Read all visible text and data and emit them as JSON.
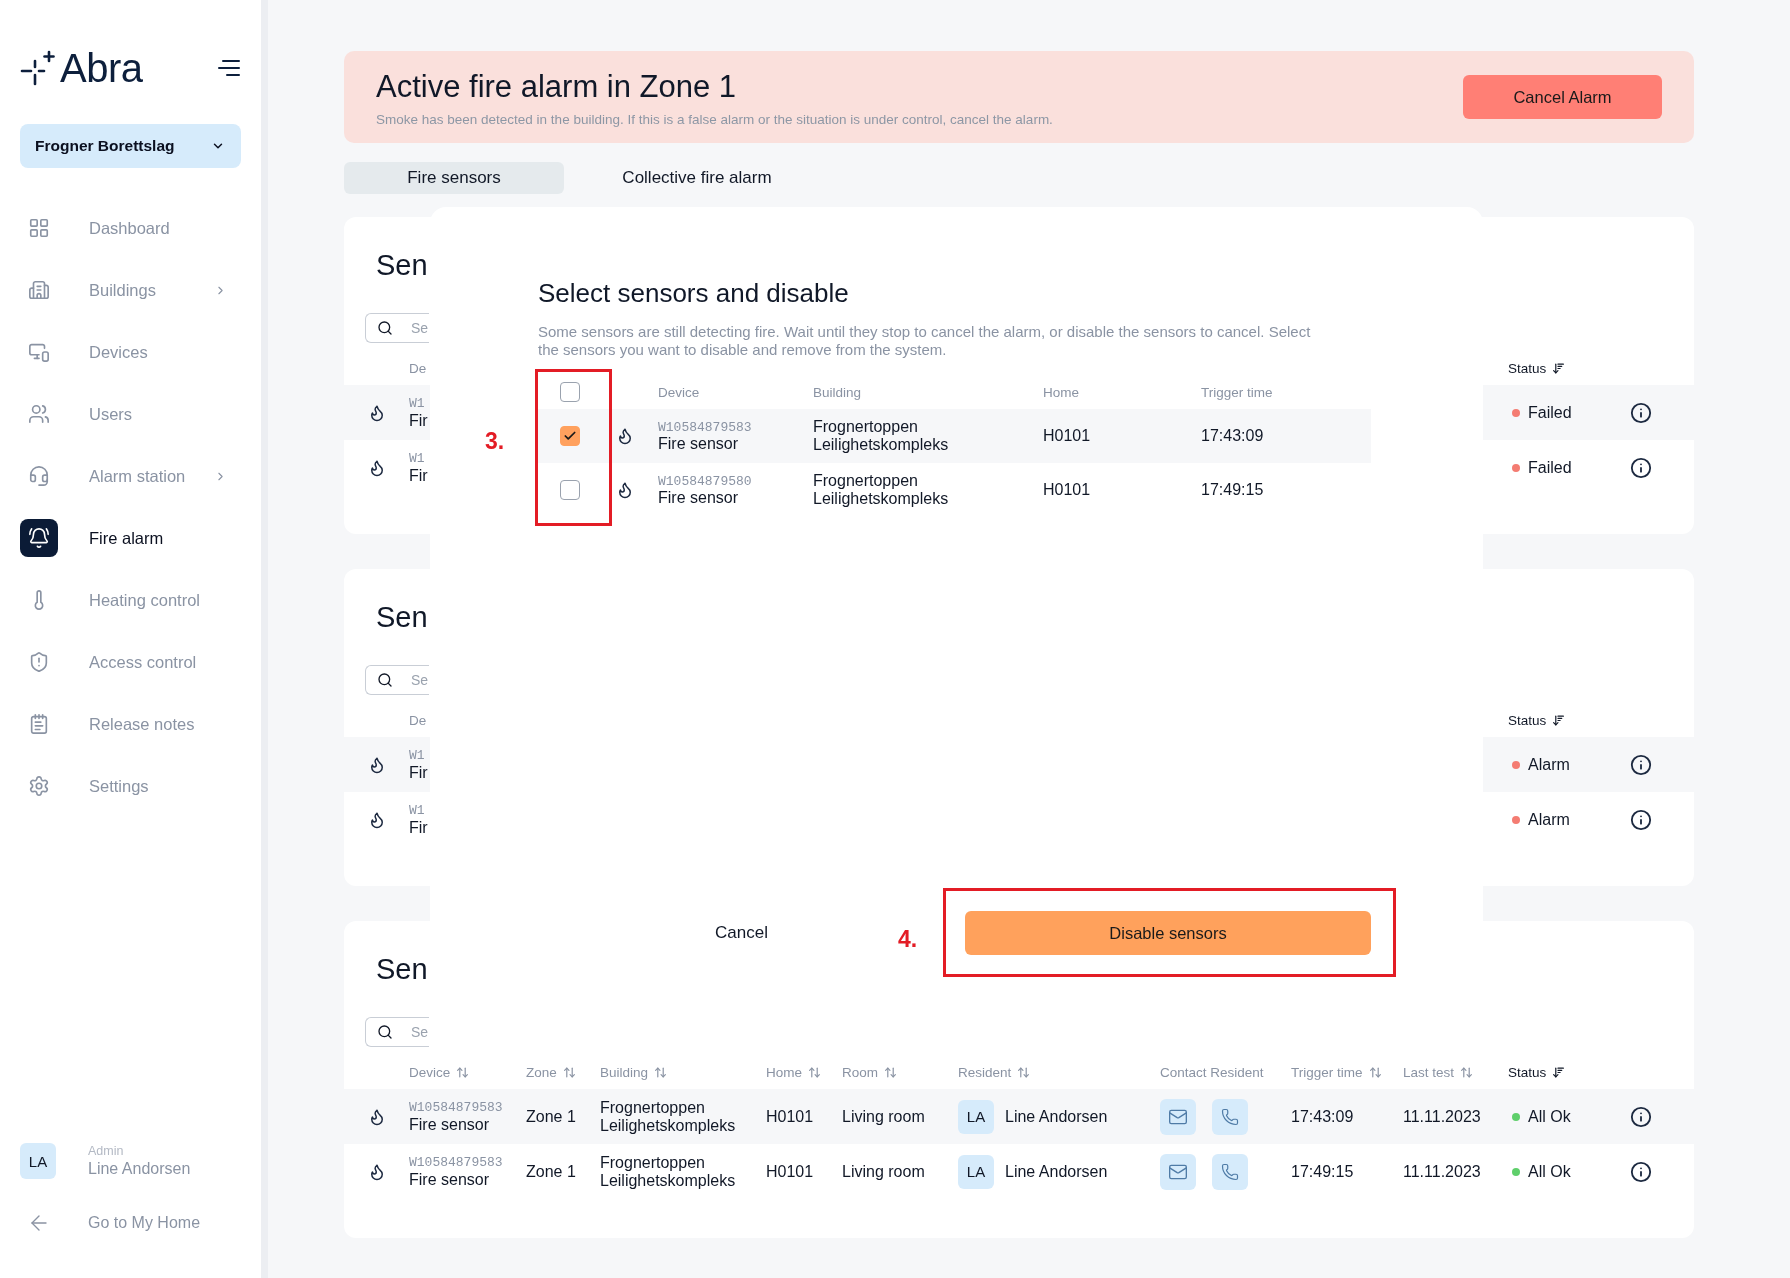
{
  "sidebar": {
    "logo": "Abra",
    "org_selector": {
      "value": "Frogner Borettslag"
    },
    "nav_items": [
      {
        "label": "Dashboard",
        "selected": false,
        "submenu": false
      },
      {
        "label": "Buildings",
        "selected": false,
        "submenu": true
      },
      {
        "label": "Devices",
        "selected": false,
        "submenu": false
      },
      {
        "label": "Users",
        "selected": false,
        "submenu": false
      },
      {
        "label": "Alarm station",
        "selected": false,
        "submenu": true
      },
      {
        "label": "Fire alarm",
        "selected": true,
        "submenu": false
      },
      {
        "label": "Heating control",
        "selected": false,
        "submenu": false
      },
      {
        "label": "Access control",
        "selected": false,
        "submenu": false
      },
      {
        "label": "Release notes",
        "selected": false,
        "submenu": false
      },
      {
        "label": "Settings",
        "selected": false,
        "submenu": false
      }
    ],
    "user": {
      "initials": "LA",
      "role": "Admin",
      "name": "Line Andorsen"
    },
    "home_link": {
      "label": "Go to My Home"
    }
  },
  "alert": {
    "title": "Active fire alarm in Zone 1",
    "message": "Smoke has been detected in the building. If this is a false alarm or the situation is under control, cancel the alarm.",
    "button": "Cancel Alarm"
  },
  "tabs": [
    {
      "label": "Fire sensors",
      "selected": true
    },
    {
      "label": "Collective fire alarm",
      "selected": false
    }
  ],
  "sensor_cards": [
    {
      "kind": "covered",
      "title": "Sen",
      "search": {
        "placeholder": "Se"
      },
      "columns": [
        {
          "label": "De",
          "sorted": false
        },
        {
          "label": "Status",
          "sortable": true,
          "sorted": true
        }
      ],
      "rows": [
        {
          "device_id": "W1",
          "device_type": "Fir",
          "status": "Failed",
          "color": "#f47c72"
        },
        {
          "device_id": "W1",
          "device_type": "Fir",
          "status": "Failed",
          "color": "#f47c72"
        }
      ]
    },
    {
      "kind": "covered",
      "title": "Sen",
      "search": {
        "placeholder": "Se"
      },
      "columns": [
        {
          "label": "De",
          "sorted": false
        },
        {
          "label": "Status",
          "sortable": true,
          "sorted": true
        }
      ],
      "rows": [
        {
          "device_id": "W1",
          "device_type": "Fir",
          "status": "Alarm",
          "color": "#f47c72"
        },
        {
          "device_id": "W1",
          "device_type": "Fir",
          "status": "Alarm",
          "color": "#f47c72"
        }
      ]
    },
    {
      "kind": "full",
      "title": "Sen",
      "search": {
        "placeholder": "Se"
      },
      "columns": [
        {
          "label": "Device",
          "sortable": true,
          "sorted": false
        },
        {
          "label": "Zone",
          "sortable": true,
          "sorted": false
        },
        {
          "label": "Building",
          "sortable": true,
          "sorted": false
        },
        {
          "label": "Home",
          "sortable": true,
          "sorted": false
        },
        {
          "label": "Room",
          "sortable": true,
          "sorted": false
        },
        {
          "label": "Resident",
          "sortable": true,
          "sorted": false
        },
        {
          "label": "Contact Resident",
          "sortable": false,
          "sorted": false
        },
        {
          "label": "Trigger time",
          "sortable": true,
          "sorted": false
        },
        {
          "label": "Last test",
          "sortable": true,
          "sorted": false
        },
        {
          "label": "Status",
          "sortable": true,
          "sorted": true
        }
      ],
      "rows": [
        {
          "device_id": "W10584879583",
          "device_type": "Fire sensor",
          "zone": "Zone 1",
          "building": "Frognertoppen Leilighetskompleks",
          "home": "H0101",
          "room": "Living room",
          "resident_initials": "LA",
          "resident": "Line Andorsen",
          "trigger_time": "17:43:09",
          "last_test": "11.11.2023",
          "status": "All Ok",
          "color": "#5fcf6b"
        },
        {
          "device_id": "W10584879583",
          "device_type": "Fire sensor",
          "zone": "Zone 1",
          "building": "Frognertoppen Leilighetskompleks",
          "home": "H0101",
          "room": "Living room",
          "resident_initials": "LA",
          "resident": "Line Andorsen",
          "trigger_time": "17:49:15",
          "last_test": "11.11.2023",
          "status": "All Ok",
          "color": "#5fcf6b"
        }
      ]
    }
  ],
  "modal": {
    "title": "Select sensors and disable",
    "description": "Some sensors are still detecting fire. Wait until they stop to cancel the alarm, or disable the sensors to cancel. Select the sensors you want to disable and remove from the system.",
    "select_all": {
      "checked": false
    },
    "columns": [
      "Device",
      "Building",
      "Home",
      "Trigger time"
    ],
    "rows": [
      {
        "checked": true,
        "device_id": "W10584879583",
        "device_type": "Fire sensor",
        "building": "Frognertoppen Leilighetskompleks",
        "home": "H0101",
        "trigger_time": "17:43:09"
      },
      {
        "checked": false,
        "device_id": "W10584879580",
        "device_type": "Fire sensor",
        "building": "Frognertoppen Leilighetskompleks",
        "home": "H0101",
        "trigger_time": "17:49:15"
      }
    ],
    "cancel_button": "Cancel",
    "confirm_button": "Disable sensors"
  },
  "annotations": [
    {
      "label": "3."
    },
    {
      "label": "4."
    }
  ]
}
